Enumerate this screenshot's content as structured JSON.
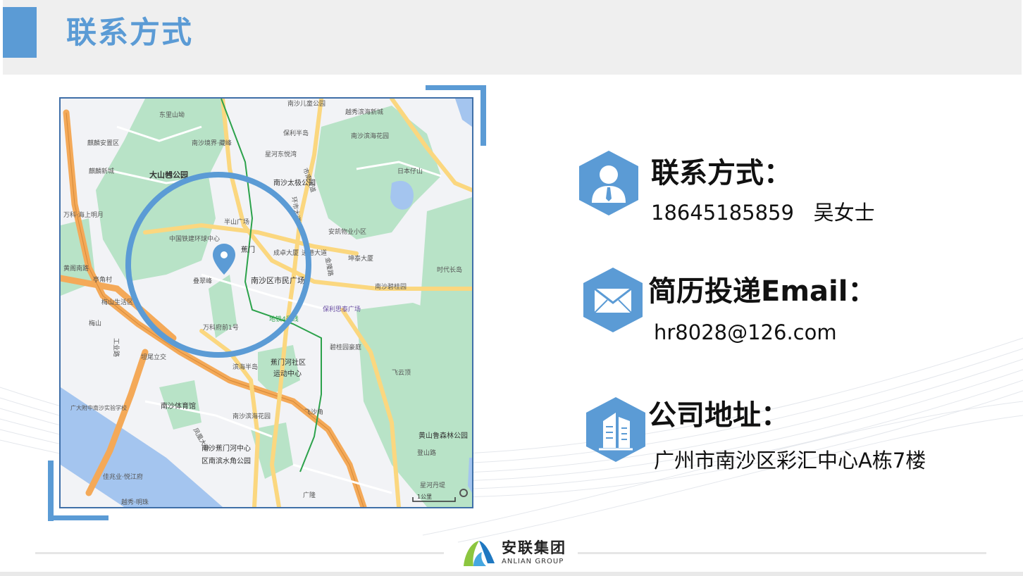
{
  "header": {
    "title": "联系方式"
  },
  "map": {
    "labels": [
      {
        "text": "南沙儿童公园"
      },
      {
        "text": "越秀滨海新城"
      },
      {
        "text": "东里山坳"
      },
      {
        "text": "保利半岛"
      },
      {
        "text": "南沙滨海花园"
      },
      {
        "text": "南沙境界·藏峰"
      },
      {
        "text": "星河东悦湾"
      },
      {
        "text": "大山乸公园"
      },
      {
        "text": "南沙太极公园"
      },
      {
        "text": "日本仔山"
      },
      {
        "text": "半山广场"
      },
      {
        "text": "安凯物业小区"
      },
      {
        "text": "中国铁建环球中心"
      },
      {
        "text": "蕉门"
      },
      {
        "text": "成卓大厦"
      },
      {
        "text": "坤泰大厦"
      },
      {
        "text": "时代长岛"
      },
      {
        "text": "叠翠峰"
      },
      {
        "text": "南沙区市民广场"
      },
      {
        "text": "南沙碧桂园"
      },
      {
        "text": "保利思泰广场"
      },
      {
        "text": "地铁4号线"
      },
      {
        "text": "万科府前1号"
      },
      {
        "text": "碧桂园豪庭"
      },
      {
        "text": "蕉门河社区"
      },
      {
        "text": "运动中心"
      },
      {
        "text": "滨海半岛"
      },
      {
        "text": "飞云顶"
      },
      {
        "text": "南沙体育馆"
      },
      {
        "text": "南沙滨海花园"
      },
      {
        "text": "飞沙角"
      },
      {
        "text": "黄山鲁森林公园"
      },
      {
        "text": "南沙蕉门河中心"
      },
      {
        "text": "区南滨水角公园"
      },
      {
        "text": "广隆"
      },
      {
        "text": "登山路"
      },
      {
        "text": "星河丹堤"
      },
      {
        "text": "工业路"
      },
      {
        "text": "坦尾立交"
      },
      {
        "text": "麒麟安置区"
      },
      {
        "text": "麒麟新城"
      },
      {
        "text": "万科·海上明月"
      },
      {
        "text": "黄阁南路"
      },
      {
        "text": "亭角村"
      },
      {
        "text": "梅山生活区"
      },
      {
        "text": "梅山"
      },
      {
        "text": "广大附中南沙实验学校"
      },
      {
        "text": "佳兆业·悦江府"
      },
      {
        "text": "越秀·明珠"
      },
      {
        "text": "市南大道"
      },
      {
        "text": "进港大道"
      },
      {
        "text": "金隆路"
      },
      {
        "text": "凤凰大道"
      },
      {
        "text": "环市大道"
      },
      {
        "text": "1公里"
      }
    ]
  },
  "contacts": [
    {
      "heading": "联系方式：",
      "value": "18645185859   吴女士",
      "icon": "user-icon"
    },
    {
      "heading": "简历投递Email：",
      "value": "hr8028@126.com",
      "icon": "envelope-icon"
    },
    {
      "heading": "公司地址：",
      "value": "广州市南沙区彩汇中心A栋7楼",
      "icon": "building-icon"
    }
  ],
  "footer": {
    "logo_cn": "安联集团",
    "logo_en": "ANLIAN GROUP"
  },
  "colors": {
    "accent": "#5b9bd5",
    "map_water": "#a4c5ef",
    "map_green": "#b8e3c7",
    "map_road": "#fbd77f",
    "map_highway": "#f4a958"
  }
}
